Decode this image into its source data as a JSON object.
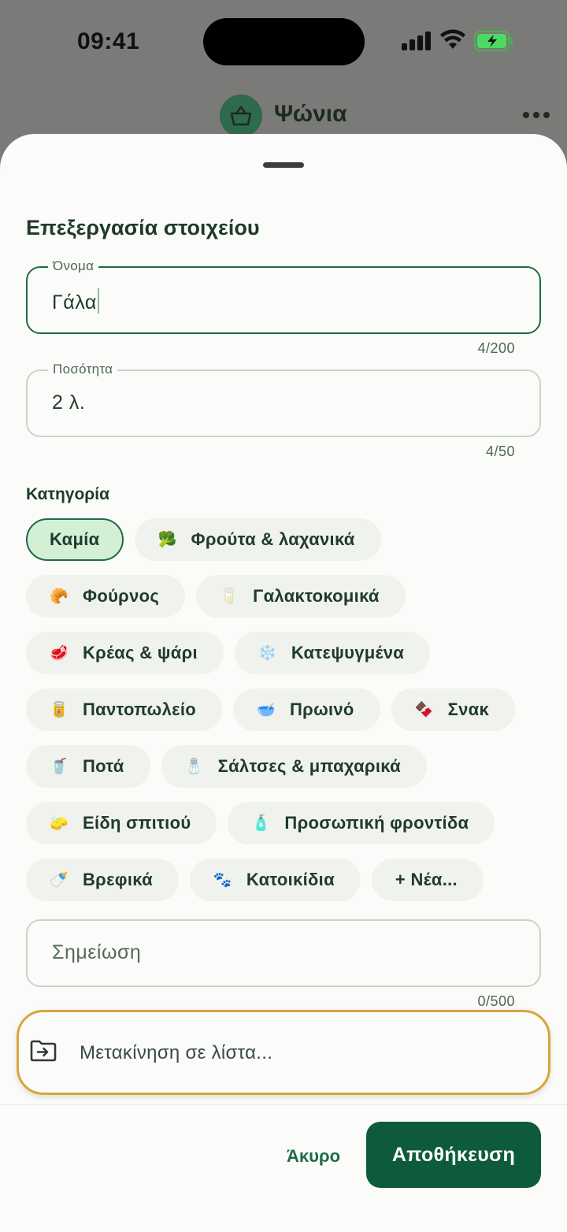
{
  "status_bar": {
    "time": "09:41"
  },
  "header": {
    "title": "Ψώνια",
    "icon": "shopping-basket-icon",
    "menu_icon": "more-horizontal-icon"
  },
  "sheet": {
    "title": "Επεξεργασία στοιχείου",
    "name_field": {
      "label": "Όνομα",
      "value": "Γάλα",
      "counter": "4/200"
    },
    "quantity_field": {
      "label": "Ποσότητα",
      "value": "2 λ.",
      "counter": "4/50"
    },
    "category": {
      "label": "Κατηγορία",
      "selected": "Καμία",
      "chips": [
        {
          "emoji": "",
          "label": "Καμία"
        },
        {
          "emoji": "🥦",
          "label": "Φρούτα & λαχανικά"
        },
        {
          "emoji": "🥐",
          "label": "Φούρνος"
        },
        {
          "emoji": "🥛",
          "label": "Γαλακτοκομικά"
        },
        {
          "emoji": "🥩",
          "label": "Κρέας & ψάρι"
        },
        {
          "emoji": "❄️",
          "label": "Κατεψυγμένα"
        },
        {
          "emoji": "🥫",
          "label": "Παντοπωλείο"
        },
        {
          "emoji": "🥣",
          "label": "Πρωινό"
        },
        {
          "emoji": "🍫",
          "label": "Σνακ"
        },
        {
          "emoji": "🥤",
          "label": "Ποτά"
        },
        {
          "emoji": "🧂",
          "label": "Σάλτσες & μπαχαρικά"
        },
        {
          "emoji": "🧽",
          "label": "Είδη σπιτιού"
        },
        {
          "emoji": "🧴",
          "label": "Προσωπική φροντίδα"
        },
        {
          "emoji": "🍼",
          "label": "Βρεφικά"
        },
        {
          "emoji": "🐾",
          "label": "Κατοικίδια"
        },
        {
          "emoji": "",
          "label": "+ Νέα..."
        }
      ]
    },
    "note_field": {
      "placeholder": "Σημείωση",
      "counter": "0/500"
    },
    "move_to_list": {
      "label": "Μετακίνηση σε λίστα...",
      "icon": "folder-move-icon"
    },
    "actions": {
      "cancel": "Άκυρο",
      "save": "Αποθήκευση"
    }
  },
  "colors": {
    "primary": "#0e5b3c",
    "selected_chip_bg": "#d3f0d5",
    "highlight_border": "#d9a53c"
  }
}
